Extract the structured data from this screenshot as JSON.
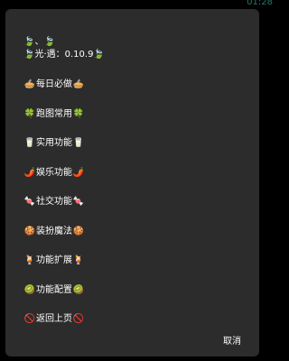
{
  "status_bar": {
    "time": "01:28"
  },
  "dialog": {
    "header_icon": "🍃",
    "header_line1_suffix": "、🍃",
    "version_text": "🍃光·遇：0.10.9🍃",
    "menu_items": [
      {
        "icon": "🥧",
        "label": "每日必做",
        "icon_name": "pie-icon"
      },
      {
        "icon": "🍀",
        "label": "跑图常用",
        "icon_name": "clover-icon"
      },
      {
        "icon": "🥛",
        "label": "实用功能",
        "icon_name": "milk-icon"
      },
      {
        "icon": "🌶️",
        "label": "娱乐功能",
        "icon_name": "chili-icon"
      },
      {
        "icon": "🍬",
        "label": "社交功能",
        "icon_name": "candy-icon"
      },
      {
        "icon": "🍪",
        "label": "装扮魔法",
        "icon_name": "cookie-icon"
      },
      {
        "icon": "🍹",
        "label": "功能扩展",
        "icon_name": "cocktail-icon"
      },
      {
        "icon": "🥝",
        "label": "功能配置",
        "icon_name": "kiwi-icon"
      },
      {
        "icon": "🚫",
        "label": "返回上页",
        "icon_name": "prohibited-icon"
      }
    ],
    "cancel_label": "取消"
  }
}
